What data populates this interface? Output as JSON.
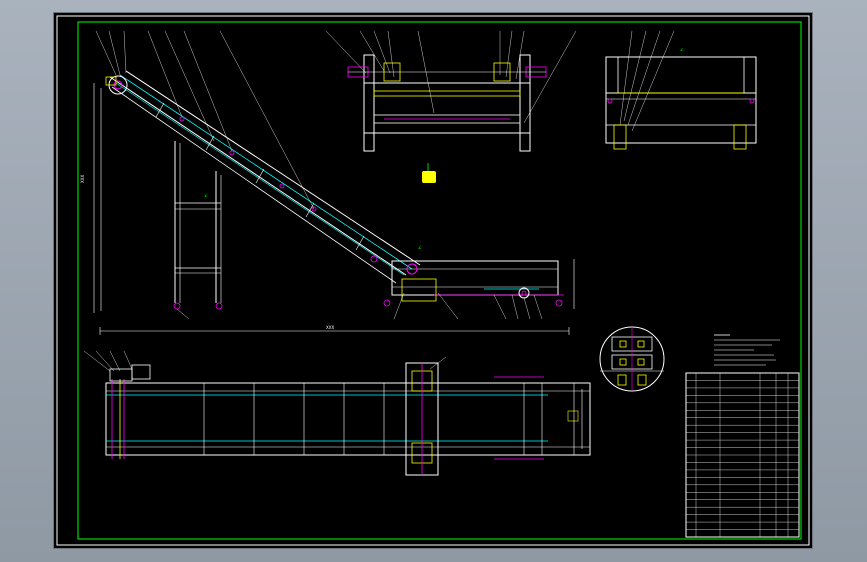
{
  "drawing": {
    "background": "#000000",
    "frame_color": "#ffffff",
    "border_color": "#00ff00",
    "colors": {
      "outline": "#ffffff",
      "belt": "#00ffff",
      "component": "#ff00ff",
      "frame_part": "#ffff00",
      "leader": "#ffffff",
      "dimension": "#ffffff"
    },
    "views": [
      {
        "key": "side_view",
        "label": ""
      },
      {
        "key": "top_view",
        "label": ""
      },
      {
        "key": "end_view_head",
        "label": ""
      },
      {
        "key": "end_view_tail",
        "label": ""
      },
      {
        "key": "detail_view",
        "label": ""
      }
    ],
    "title_block": {
      "notes_heading": "",
      "rows": 22
    }
  }
}
